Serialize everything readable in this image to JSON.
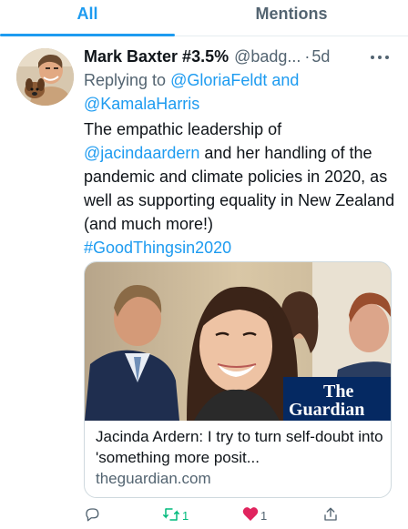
{
  "tabs": [
    {
      "label": "All",
      "active": true
    },
    {
      "label": "Mentions",
      "active": false
    }
  ],
  "tweet": {
    "author_name": "Mark Baxter #3.5%",
    "handle": "@badg...",
    "separator": "·",
    "time": "5d",
    "reply_prefix": "Replying to ",
    "reply_to_1": "@GloriaFeldt",
    "reply_and": " and",
    "reply_to_2": "@KamalaHarris",
    "text_part1": "The empathic leadership of",
    "text_mention": "@jacindaardern",
    "text_part2": " and her handling of the pandemic and climate policies in 2020, as well as supporting equality in New Zealand (and much more!)",
    "hashtag": "#GoodThingsin2020",
    "card": {
      "logo_line1": "The",
      "logo_line2": "Guardian",
      "title": "Jacinda Ardern: I try to turn self-doubt into 'something more posit...",
      "domain": "theguardian.com"
    },
    "actions": {
      "reply_count": "",
      "retweet_count": "1",
      "like_count": "1",
      "share_count": ""
    }
  },
  "colors": {
    "accent": "#1d9bf0",
    "retweet": "#00ba7c",
    "like": "#f91880",
    "secondary_text": "#536471",
    "guardian_blue": "#052962"
  },
  "icons": [
    "more-icon",
    "reply-icon",
    "retweet-icon",
    "heart-icon",
    "share-icon"
  ]
}
